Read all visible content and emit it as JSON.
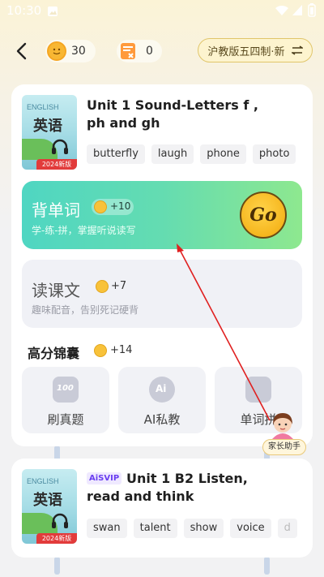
{
  "status_bar": {
    "time": "10:30"
  },
  "header": {
    "coins": "30",
    "tasks_count": "0",
    "version_label": "沪教版五四制·新"
  },
  "lesson1": {
    "book": {
      "cover_title": "英语",
      "cover_en": "ENGLISH",
      "edition_badge": "2024新版"
    },
    "title_line1": "Unit 1 Sound-Letters f ,",
    "title_line2": "ph and gh",
    "tags": [
      "butterfly",
      "laugh",
      "phone",
      "photo"
    ],
    "task_vocab": {
      "title": "背单词",
      "reward": "+10",
      "subtitle": "学-练-拼，掌握听说读写",
      "go_label": "Go"
    },
    "task_text": {
      "title": "读课文",
      "reward": "+7",
      "subtitle": "趣味配音，告别死记硬背"
    },
    "section": {
      "title": "高分锦囊",
      "reward": "+14"
    },
    "tiles": [
      {
        "label": "刷真题",
        "icon": "exam-paper-icon"
      },
      {
        "label": "AI私教",
        "icon": "ai-chat-icon"
      },
      {
        "label": "单词拼",
        "icon": "spelling-icon"
      }
    ],
    "tile_icon_text": {
      "exam": "100",
      "ai": "Ai"
    }
  },
  "lesson2": {
    "book": {
      "cover_title": "英语",
      "cover_en": "ENGLISH",
      "edition_badge": "2024新版"
    },
    "badge": "AiSVIP",
    "title_line1": "Unit 1 B2 Listen,",
    "title_line2": "read and think",
    "tags": [
      "swan",
      "talent",
      "show",
      "voice",
      "d"
    ]
  },
  "helper": {
    "label": "家长助手"
  },
  "colors": {
    "accent_green": "#5fdbb4",
    "coin": "#f8b733",
    "annotation_arrow": "#e02020"
  }
}
